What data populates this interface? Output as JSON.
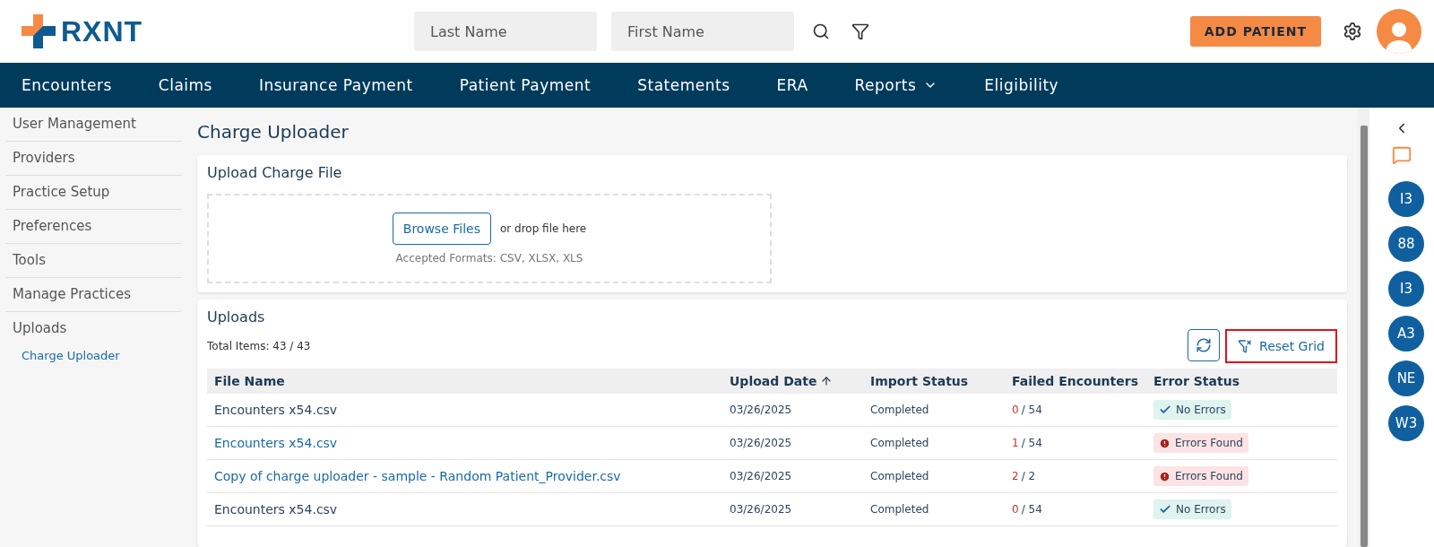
{
  "header": {
    "logo": "RXNT",
    "search_fields": [
      {
        "placeholder": "Last Name"
      },
      {
        "placeholder": "First Name"
      }
    ],
    "add_button": "ADD PATIENT"
  },
  "nav": [
    {
      "label": "Encounters",
      "dropdown": false
    },
    {
      "label": "Claims",
      "dropdown": false
    },
    {
      "label": "Insurance Payment",
      "dropdown": false
    },
    {
      "label": "Patient Payment",
      "dropdown": false
    },
    {
      "label": "Statements",
      "dropdown": false
    },
    {
      "label": "ERA",
      "dropdown": false
    },
    {
      "label": "Reports",
      "dropdown": true
    },
    {
      "label": "Eligibility",
      "dropdown": false
    }
  ],
  "sidebar": {
    "items": [
      {
        "label": "User Management"
      },
      {
        "label": "Providers"
      },
      {
        "label": "Practice Setup"
      },
      {
        "label": "Preferences"
      },
      {
        "label": "Tools"
      },
      {
        "label": "Manage Practices"
      },
      {
        "label": "Uploads",
        "children": [
          {
            "label": "Charge Uploader",
            "selected": true
          }
        ]
      }
    ]
  },
  "page_title": "Charge Uploader",
  "upload_card": {
    "title": "Upload Charge File",
    "browse_button": "Browse Files",
    "drop_hint": "or drop file here",
    "formats": "Accepted Formats: CSV, XLSX, XLS"
  },
  "uploads": {
    "title": "Uploads",
    "total": "Total Items: 43 / 43",
    "reset_button": "Reset Grid",
    "columns": [
      {
        "label": "File Name",
        "sorted": false
      },
      {
        "label": "Upload Date",
        "sorted": true
      },
      {
        "label": "Import Status",
        "sorted": false
      },
      {
        "label": "Failed Encounters",
        "sorted": false
      },
      {
        "label": "Error Status",
        "sorted": false
      }
    ],
    "rows": [
      {
        "file": "Encounters x54.csv",
        "link": false,
        "date": "03/26/2025",
        "import": "Completed",
        "failed": "0",
        "total": "/ 54",
        "status": "No Errors",
        "kind": "ok"
      },
      {
        "file": "Encounters x54.csv",
        "link": true,
        "date": "03/26/2025",
        "import": "Completed",
        "failed": "1",
        "total": "/ 54",
        "status": "Errors Found",
        "kind": "error"
      },
      {
        "file": "Copy of charge uploader - sample - Random Patient_Provider.csv",
        "link": true,
        "date": "03/26/2025",
        "import": "Completed",
        "failed": "2",
        "total": "/ 2",
        "status": "Errors Found",
        "kind": "error"
      },
      {
        "file": "Encounters x54.csv",
        "link": false,
        "date": "03/26/2025",
        "import": "Completed",
        "failed": "0",
        "total": "/ 54",
        "status": "No Errors",
        "kind": "ok"
      }
    ]
  },
  "right_rail": {
    "badges": [
      "I3",
      "88",
      "I3",
      "A3",
      "NE",
      "W3"
    ]
  }
}
